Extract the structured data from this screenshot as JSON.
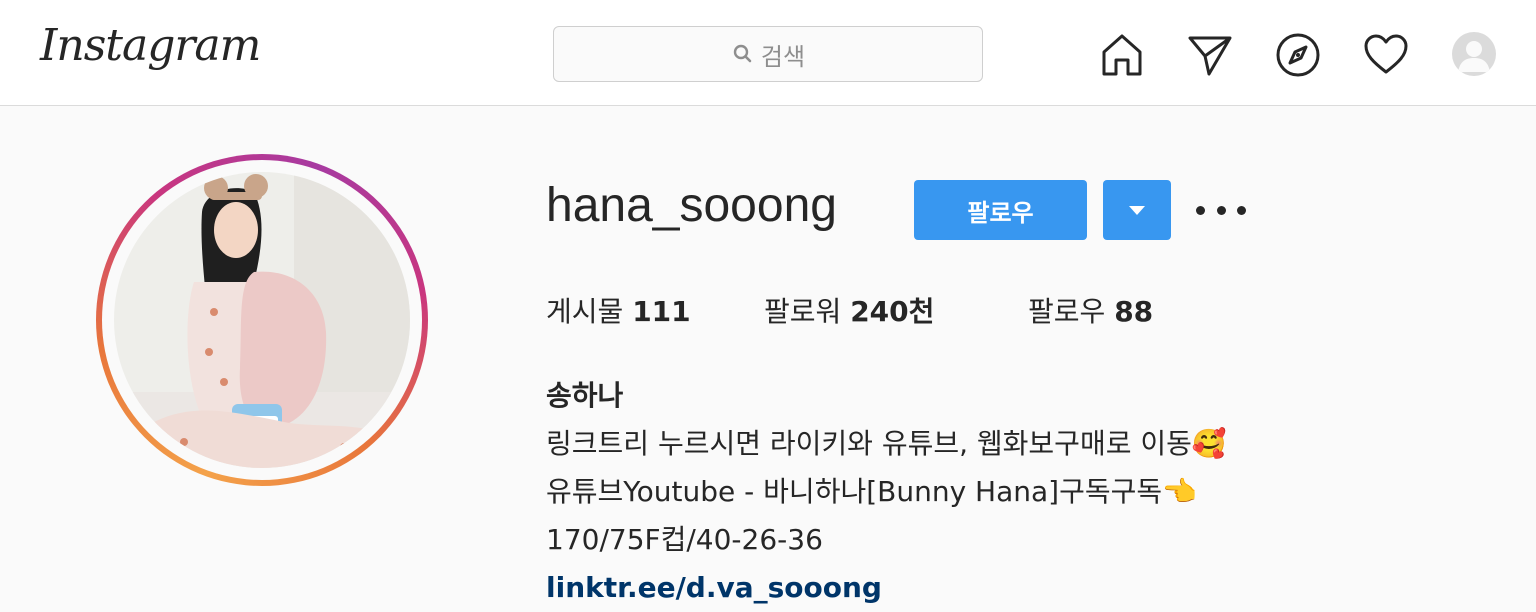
{
  "header": {
    "logo": "Instagram",
    "search_placeholder": "검색",
    "icons": [
      "home-icon",
      "direct-message-icon",
      "explore-icon",
      "activity-heart-icon",
      "profile-avatar"
    ]
  },
  "profile": {
    "username": "hana_sooong",
    "follow_label": "팔로우",
    "stats": {
      "posts_label": "게시물",
      "posts_value": "111",
      "followers_label": "팔로워",
      "followers_value": "240천",
      "following_label": "팔로우",
      "following_value": "88"
    },
    "full_name": "송하나",
    "bio": [
      "링크트리 누르시면 라이키와 유튜브, 웹화보구매로 이동🥰",
      "유튜브Youtube - 바니하나[Bunny Hana]구독구독👈",
      "170/75F컵/40-26-36"
    ],
    "link": "linktr.ee/d.va_sooong"
  },
  "colors": {
    "accent": "#3897f0",
    "link": "#003569",
    "text": "#262626",
    "background": "#fafafa"
  }
}
